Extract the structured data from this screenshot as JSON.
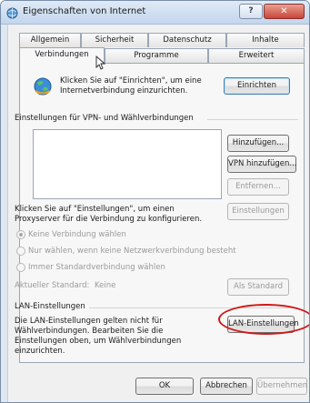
{
  "window": {
    "title": "Eigenschaften von Internet",
    "help": "?",
    "close": "✕"
  },
  "tabs": {
    "row1": [
      "Allgemein",
      "Sicherheit",
      "Datenschutz",
      "Inhalte"
    ],
    "row2": [
      "Verbindungen",
      "Programme",
      "Erweitert"
    ],
    "active": "Verbindungen"
  },
  "setup": {
    "text_line1": "Klicken Sie auf \"Einrichten\", um eine",
    "text_line2": "Internetverbindung einzurichten.",
    "button": "Einrichten"
  },
  "vpn": {
    "heading": "Einstellungen für VPN- und Wählverbindungen",
    "add": "Hinzufügen...",
    "add_vpn": "VPN hinzufügen...",
    "remove": "Entfernen...",
    "proxy_text1": "Klicken Sie auf \"Einstellungen\", um einen",
    "proxy_text2": "Proxyserver für die Verbindung zu konfigurieren.",
    "settings": "Einstellungen",
    "radios": [
      "Keine Verbindung wählen",
      "Nur wählen, wenn keine Netzwerkverbindung besteht",
      "Immer Standardverbindung wählen"
    ],
    "radio_checked_index": 0,
    "current_label": "Aktueller Standard:",
    "current_value": "Keine",
    "set_default": "Als Standard"
  },
  "lan": {
    "heading": "LAN-Einstellungen",
    "text": [
      "Die LAN-Einstellungen gelten nicht für",
      "Wählverbindungen. Bearbeiten Sie die",
      "Einstellungen oben, um Wählverbindungen",
      "einzurichten."
    ],
    "button": "LAN-Einstellungen"
  },
  "footer": {
    "ok": "OK",
    "cancel": "Abbrechen",
    "apply": "Übernehmen"
  },
  "colors": {
    "annotation_circle": "#d01818",
    "titlebar": "#c3d6ec",
    "close": "#c9453a"
  }
}
